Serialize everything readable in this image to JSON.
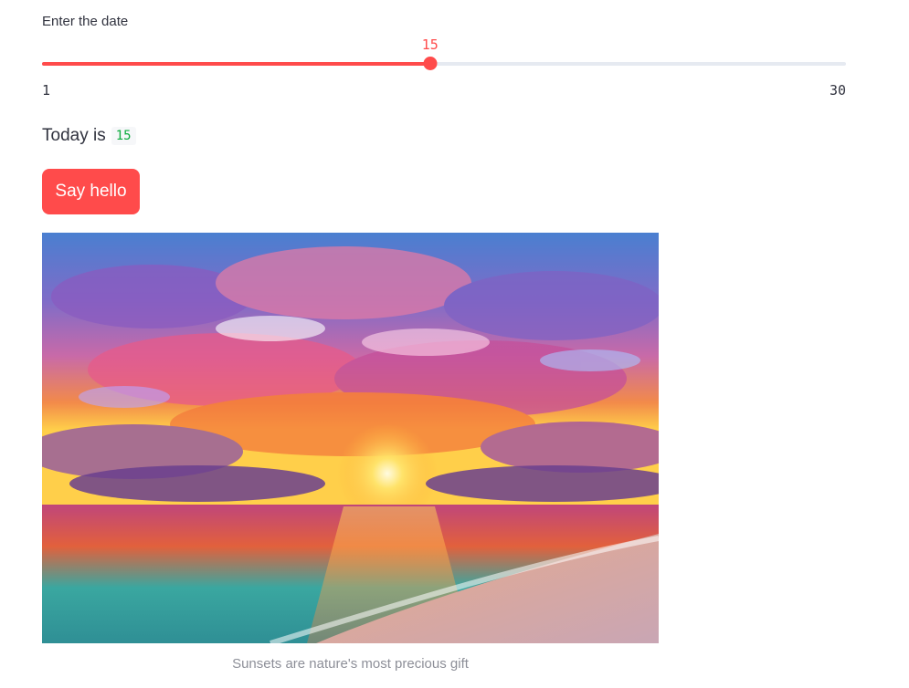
{
  "slider": {
    "label": "Enter the date",
    "value": 15,
    "value_text": "15",
    "min": 1,
    "min_text": "1",
    "max": 30,
    "max_text": "30",
    "accent_color": "#ff4b4b",
    "track_color": "#e6eaf1"
  },
  "today": {
    "prefix": "Today is",
    "value": "15",
    "code_color": "#09ab3b"
  },
  "button": {
    "label": "Say hello",
    "color": "#ff4b4b"
  },
  "image": {
    "caption": "Sunsets are nature's most precious gift"
  }
}
